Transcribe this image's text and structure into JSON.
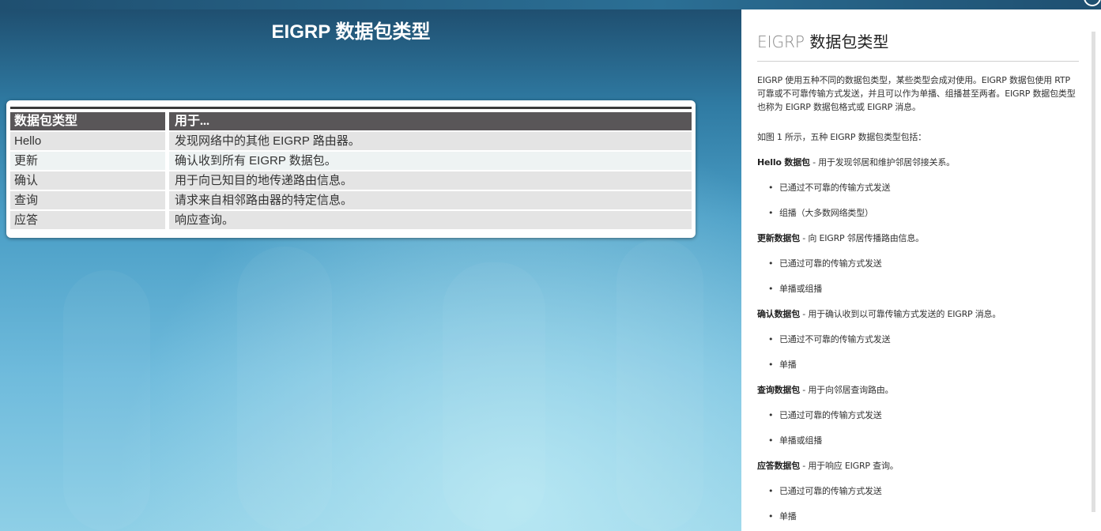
{
  "slide": {
    "title": "EIGRP 数据包类型",
    "table": {
      "headers": [
        "数据包类型",
        "用于..."
      ],
      "rows": [
        [
          "Hello",
          "发现网络中的其他 EIGRP 路由器。"
        ],
        [
          "更新",
          "确认收到所有 EIGRP 数据包。"
        ],
        [
          "确认",
          "用于向已知目的地传递路由信息。"
        ],
        [
          "查询",
          "请求来自相邻路由器的特定信息。"
        ],
        [
          "应答",
          "响应查询。"
        ]
      ]
    }
  },
  "panel": {
    "title_prefix": "EIGRP",
    "title_main": "数据包类型",
    "intro": "EIGRP 使用五种不同的数据包类型，某些类型会成对使用。EIGRP 数据包使用 RTP 可靠或不可靠传输方式发送，并且可以作为单播、组播甚至两者。EIGRP 数据包类型也称为 EIGRP 数据包格式或 EIGRP 消息。",
    "lead": "如图 1 所示，五种 EIGRP 数据包类型包括：",
    "packets": [
      {
        "name": "Hello 数据包",
        "desc": " - 用于发现邻居和维护邻居邻接关系。",
        "bullets": [
          "已通过不可靠的传输方式发送",
          "组播（大多数网络类型）"
        ]
      },
      {
        "name": "更新数据包",
        "desc": " - 向 EIGRP 邻居传播路由信息。",
        "bullets": [
          "已通过可靠的传输方式发送",
          "单播或组播"
        ]
      },
      {
        "name": "确认数据包",
        "desc": " - 用于确认收到以可靠传输方式发送的 EIGRP 消息。",
        "bullets": [
          "已通过不可靠的传输方式发送",
          "单播"
        ]
      },
      {
        "name": "查询数据包",
        "desc": " - 用于向邻居查询路由。",
        "bullets": [
          "已通过可靠的传输方式发送",
          "单播或组播"
        ]
      },
      {
        "name": "应答数据包",
        "desc": " - 用于响应 EIGRP 查询。",
        "bullets": [
          "已通过可靠的传输方式发送",
          "单播"
        ]
      }
    ]
  },
  "colors": {
    "table_header_bg": "#595658",
    "accent_handle": "#2b9fd6",
    "stage_top": "#1f4f70",
    "stage_bottom": "#8ecfe6"
  }
}
